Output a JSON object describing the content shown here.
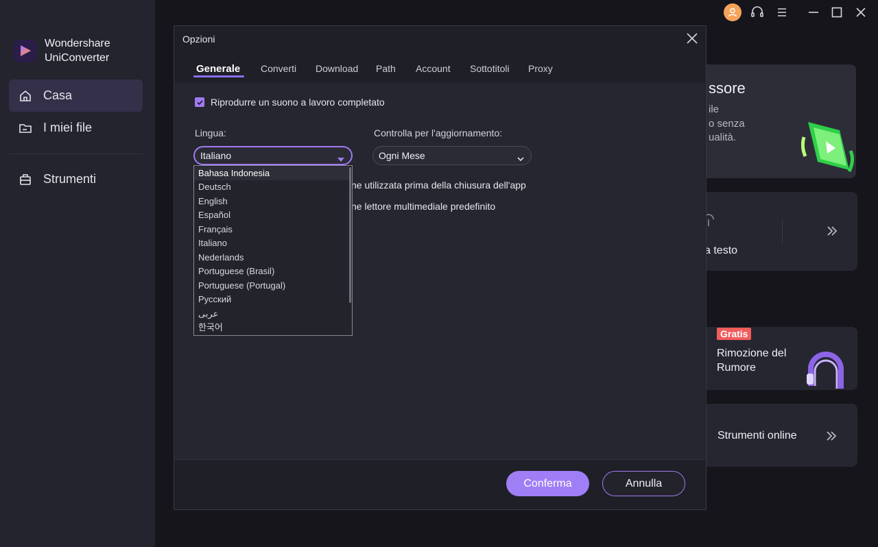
{
  "app": {
    "brand_line1": "Wondershare",
    "brand_line2": "UniConverter"
  },
  "sidebar": {
    "items": [
      {
        "label": "Casa",
        "icon": "home-icon",
        "active": true
      },
      {
        "label": "I miei file",
        "icon": "folder-icon",
        "active": false
      },
      {
        "label": "Strumenti",
        "icon": "toolbox-icon",
        "active": false
      }
    ]
  },
  "background_cards": {
    "compressor_title": "ssore",
    "compressor_desc1": "ile",
    "compressor_desc2": "o senza",
    "compressor_desc3": "ualità.",
    "speech_text": "a testo",
    "badge": "Gratis",
    "noise_line1": "Rimozione del",
    "noise_line2": "Rumore",
    "online_tools": "Strumenti online"
  },
  "dialog": {
    "title": "Opzioni",
    "tabs": [
      {
        "label": "Generale",
        "active": true
      },
      {
        "label": "Converti"
      },
      {
        "label": "Download"
      },
      {
        "label": "Path"
      },
      {
        "label": "Account"
      },
      {
        "label": "Sottotitoli"
      },
      {
        "label": "Proxy"
      }
    ],
    "sound_checkbox_label": "Riprodurre un suono a lavoro completato",
    "language_label": "Lingua:",
    "language_value": "Italiano",
    "update_label": "Controlla per l'aggiornamento:",
    "update_value": "Ogni Mese",
    "hidden_row1": "ne utilizzata prima della chiusura dell'app",
    "hidden_row2": "ne lettore multimediale predefinito",
    "language_options": [
      "Bahasa Indonesia",
      "Deutsch",
      "English",
      "Español",
      "Français",
      "Italiano",
      "Nederlands",
      "Portuguese (Brasil)",
      "Portuguese (Portugal)",
      "Русский",
      "عربى",
      "한국어"
    ],
    "confirm_label": "Conferma",
    "cancel_label": "Annulla"
  },
  "colors": {
    "accent": "#9f7bf2",
    "badge": "#f25c5c"
  }
}
